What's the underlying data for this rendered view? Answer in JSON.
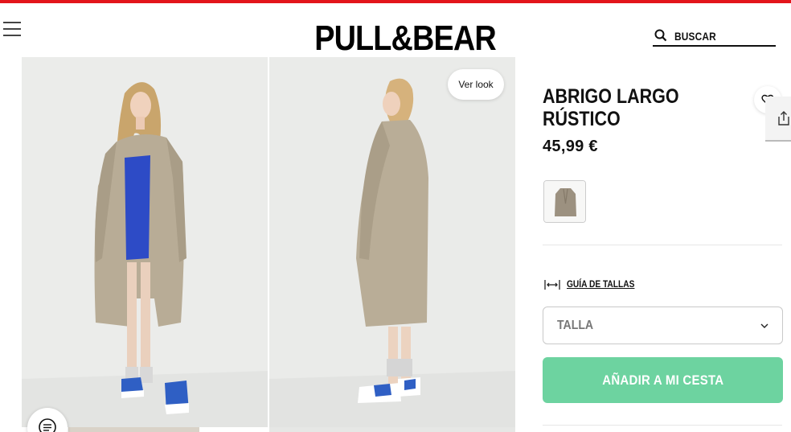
{
  "header": {
    "logo": "PULL&BEAR",
    "search_label": "BUSCAR",
    "accent_color": "#e3151b"
  },
  "gallery": {
    "ver_look_label": "Ver look",
    "images": [
      "model-front-coat-photo",
      "model-side-coat-photo"
    ]
  },
  "product": {
    "title": "ABRIGO LARGO RÚSTICO",
    "price": "45,99 €",
    "size_guide_label": "GUÍA DE TALLAS",
    "size_select_placeholder": "TALLA",
    "add_to_cart_label": "AÑADIR A MI CESTA",
    "add_button_color": "#6dd3a0"
  },
  "icons": [
    "menu-icon",
    "search-icon",
    "heart-icon",
    "share-icon",
    "ruler-icon",
    "chevron-down-icon",
    "chat-icon"
  ]
}
